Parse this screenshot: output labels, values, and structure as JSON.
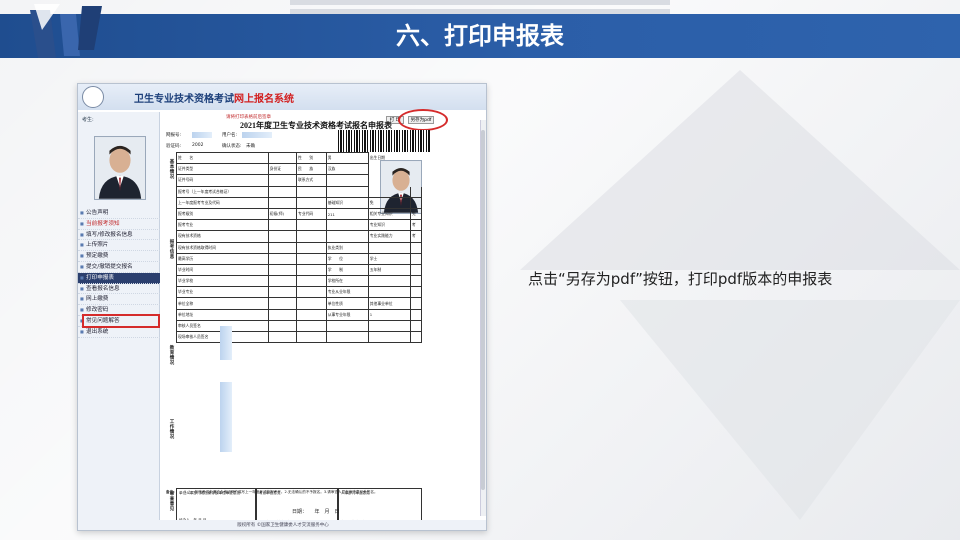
{
  "slide": {
    "title": "六、打印申报表",
    "caption": "点击“另存为pdf”按钮，打印pdf版本的申报表",
    "accent_color": "#2b5ea8",
    "highlight_color": "#d52b2b"
  },
  "screenshot": {
    "app_title_blue": "卫生专业技术资格考试",
    "app_title_red": "网上报名系统",
    "nav_user_label": "考生:",
    "nav_items": [
      "公告声明",
      "当前报考须知",
      "填写/修改报名信息",
      "上传照片",
      "预定缴费",
      "提交/撤销提交报名",
      "打印申报表",
      "查看报名信息",
      "网上缴费",
      "修改密码",
      "常见问题解答",
      "退出系统"
    ],
    "buttons": {
      "print": "打 印",
      "save_pdf": "另存为pdf"
    },
    "form_notice": "请将打印表格前后签章",
    "form_title": "2021年度卫生专业技术资格考试报名申报表",
    "meta": {
      "serial_label": "网报号:",
      "user_label": "用户名:",
      "confirm_code_label": "验证码:",
      "confirm_code_value": "2002",
      "confirm_status_label": "确认状态:",
      "confirm_status_value": "未确"
    },
    "section_labels": {
      "basic": "基本情况",
      "exam": "报考信息",
      "edu": "教育情况",
      "work": "工作情况",
      "review": "审查意见"
    },
    "rows": [
      [
        "姓　　名",
        "",
        "性　　别",
        "男",
        "出生日期",
        ""
      ],
      [
        "证件类型",
        "身份证",
        "民　　族",
        "汉族",
        "",
        ""
      ],
      [
        "证件号码",
        "",
        "联系方式",
        "",
        "",
        ""
      ],
      [
        "报考号（上一年度考试合格证）",
        "",
        "",
        "",
        "",
        ""
      ],
      [
        "上一年度报考专业及代码",
        "",
        "",
        "基础知识",
        "免",
        ""
      ],
      [
        "报考级别",
        "初级(师)",
        "专业代码",
        "211",
        "相关专业知识",
        "免"
      ],
      [
        "报考专业",
        "",
        "",
        "",
        "专业知识",
        "考"
      ],
      [
        "现有技术资格",
        "",
        "",
        "",
        "专业实践能力",
        "考"
      ],
      [
        "现有技术资格取得时间",
        "",
        "",
        "执业类别",
        "",
        ""
      ],
      [
        "最高学历",
        "",
        "",
        "学　　位",
        "学士",
        ""
      ],
      [
        "毕业时间",
        "",
        "",
        "学　　制",
        "五年制",
        ""
      ],
      [
        "毕业学校",
        "",
        "",
        "学校所在",
        "",
        ""
      ],
      [
        "毕业专业",
        "",
        "",
        "专业从业年限",
        "",
        ""
      ],
      [
        "单位全称",
        "",
        "",
        "单位性质",
        "其他事业单位",
        ""
      ],
      [
        "单位地址",
        "",
        "",
        "从事专业年限",
        "1",
        ""
      ],
      [
        "审核人员签名",
        "",
        "",
        "",
        "",
        ""
      ],
      [
        "现场审核人员签名",
        "",
        "",
        "",
        "",
        ""
      ]
    ],
    "review_cells": [
      "单位人事部门或档案存放单位审查意见：",
      "考点审查意见",
      "人事部门审查意见"
    ],
    "review_signers": [
      "经办人　年 月 日",
      "考点负责人签章　年 月 日",
      "负责人签字　年 月 日"
    ],
    "note_label": "备注：",
    "note_text": "1.上一年度考试未通过合格证明的填写上一年度考试的报考号。2.无法确认的不予报名。3.请审查人员在审查意见处签名。",
    "date_text": "日期：　　年　月　日",
    "footer": "版权所有 ©国家卫生健康委人才交流服务中心"
  }
}
